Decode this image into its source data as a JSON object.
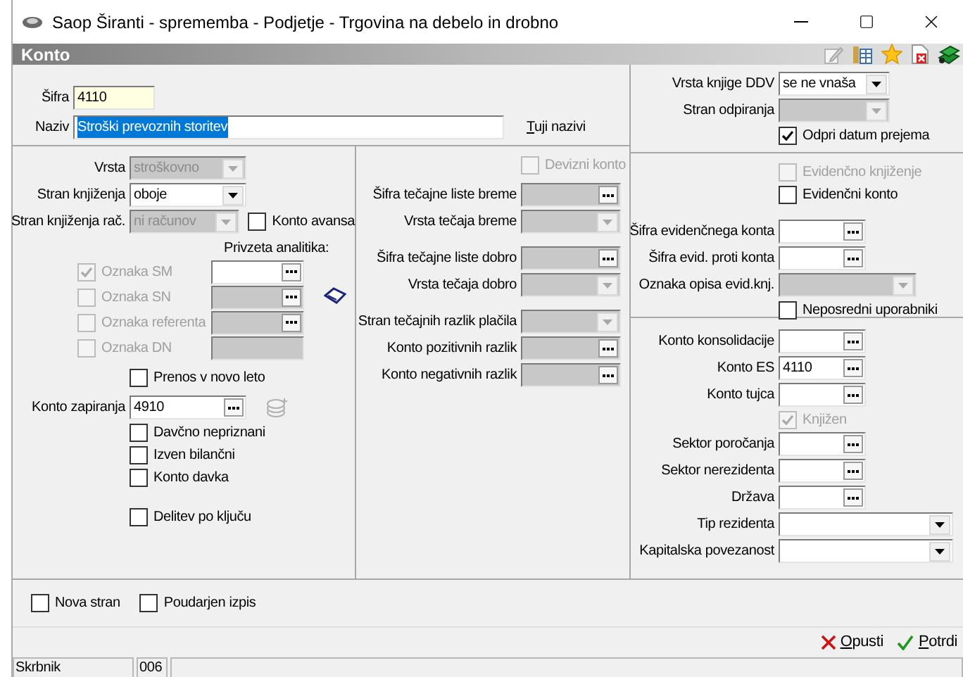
{
  "window": {
    "title": "Saop Širanti - sprememba - Podjetje - Trgovina na debelo in drobno"
  },
  "panel": {
    "title": "Konto"
  },
  "general": {
    "code": {
      "label": "Šifra",
      "value": "4110"
    },
    "name": {
      "label": "Naziv",
      "value": "Stroški prevoznih storitev",
      "selected": true
    },
    "link": "Tuji nazivi"
  },
  "left_column": [
    [
      {
        "kind": "select",
        "label": "Vrsta",
        "value": "stroškovno",
        "disabled": true
      },
      {
        "kind": "select",
        "label": "Stran knjiženja",
        "value": "oboje",
        "disabled": false
      },
      {
        "kind": "select",
        "label": "Stran knjiženja rač.",
        "value": "ni računov",
        "disabled": true,
        "side_check": {
          "label": "Konto avansa",
          "checked": false,
          "disabled": false
        }
      }
    ],
    [
      {
        "kind": "analytics",
        "title": "Privzeta analitika:",
        "rows": [
          {
            "label": "Oznaka SM",
            "checked": true,
            "disabled": true,
            "field": {
              "kind": "lookup",
              "disabled": false
            }
          },
          {
            "label": "Oznaka SN",
            "checked": false,
            "disabled": true,
            "field": {
              "kind": "lookup",
              "disabled": true
            }
          },
          {
            "label": "Oznaka referenta",
            "checked": false,
            "disabled": true,
            "field": {
              "kind": "lookup",
              "disabled": true
            }
          },
          {
            "label": "Oznaka DN",
            "checked": false,
            "disabled": true,
            "field": {
              "kind": "plain",
              "disabled": true
            }
          }
        ]
      }
    ],
    [
      {
        "kind": "check",
        "label": "Prenos v novo leto",
        "checked": false,
        "disabled": false
      }
    ],
    [
      {
        "kind": "lookup",
        "label": "Konto zapiranja",
        "value": "4910",
        "disabled": false
      },
      {
        "kind": "check",
        "label": "Davčno nepriznani",
        "checked": false,
        "disabled": false
      },
      {
        "kind": "check",
        "label": "Izven bilančni",
        "checked": false,
        "disabled": false
      },
      {
        "kind": "check",
        "label": "Konto davka",
        "checked": false,
        "disabled": false
      }
    ],
    [
      {
        "kind": "check",
        "label": "Delitev po ključu",
        "checked": false,
        "disabled": false
      }
    ]
  ],
  "middle_column": [
    [
      {
        "kind": "check",
        "label": "Devizni konto",
        "checked": false,
        "disabled": true
      }
    ],
    [
      {
        "kind": "lookup",
        "label": "Šifra tečajne liste breme",
        "disabled": true
      },
      {
        "kind": "select",
        "label": "Vrsta tečaja breme",
        "disabled": true
      }
    ],
    [
      {
        "kind": "lookup",
        "label": "Šifra tečajne liste dobro",
        "disabled": true
      },
      {
        "kind": "select",
        "label": "Vrsta tečaja dobro",
        "disabled": true
      }
    ],
    [
      {
        "kind": "select",
        "label": "Stran tečajnih razlik plačila",
        "disabled": true
      },
      {
        "kind": "lookup",
        "label": "Konto pozitivnih razlik",
        "disabled": true
      },
      {
        "kind": "lookup",
        "label": "Konto negativnih razlik",
        "disabled": true
      }
    ]
  ],
  "right_column": [
    [
      {
        "kind": "select",
        "label": "Vrsta knjige DDV",
        "value": "se ne vnaša",
        "disabled": false
      },
      {
        "kind": "select",
        "label": "Stran odpiranja",
        "disabled": true
      },
      {
        "kind": "check",
        "label": "Odpri datum prejema",
        "checked": true,
        "disabled": false
      }
    ],
    [
      {
        "kind": "check",
        "label": "Evidenčno knjiženje",
        "checked": false,
        "disabled": true
      },
      {
        "kind": "check",
        "label": "Evidenčni konto",
        "checked": false,
        "disabled": false
      },
      {
        "kind": "lookup",
        "label": "Šifra evidenčnega konta",
        "disabled": false
      },
      {
        "kind": "lookup",
        "label": "Šifra evid. proti konta",
        "disabled": false
      },
      {
        "kind": "select",
        "label": "Oznaka opisa evid.knj.",
        "disabled": true
      },
      {
        "kind": "check",
        "label": "Neposredni uporabniki",
        "checked": false,
        "disabled": false
      }
    ],
    [
      {
        "kind": "lookup",
        "label": "Konto konsolidacije",
        "disabled": false
      },
      {
        "kind": "lookup",
        "label": "Konto ES",
        "value": "4110",
        "disabled": false
      },
      {
        "kind": "lookup",
        "label": "Konto tujca",
        "disabled": false
      },
      {
        "kind": "check",
        "label": "Knjižen",
        "checked": true,
        "disabled": true
      },
      {
        "kind": "lookup",
        "label": "Sektor poročanja",
        "disabled": false
      },
      {
        "kind": "lookup",
        "label": "Sektor nerezidenta",
        "disabled": false
      },
      {
        "kind": "lookup",
        "label": "Država",
        "disabled": false
      },
      {
        "kind": "select",
        "label": "Tip rezidenta",
        "disabled": false
      },
      {
        "kind": "select",
        "label": "Kapitalska povezanost",
        "disabled": false
      }
    ]
  ],
  "options": [
    {
      "label": "Nova stran",
      "checked": false
    },
    {
      "label": "Poudarjen izpis",
      "checked": false
    }
  ],
  "buttons": [
    {
      "kind": "cancel",
      "label": "Opusti"
    },
    {
      "kind": "confirm",
      "label": "Potrdi"
    }
  ],
  "status_bar": [
    "Skrbnik",
    "006"
  ]
}
